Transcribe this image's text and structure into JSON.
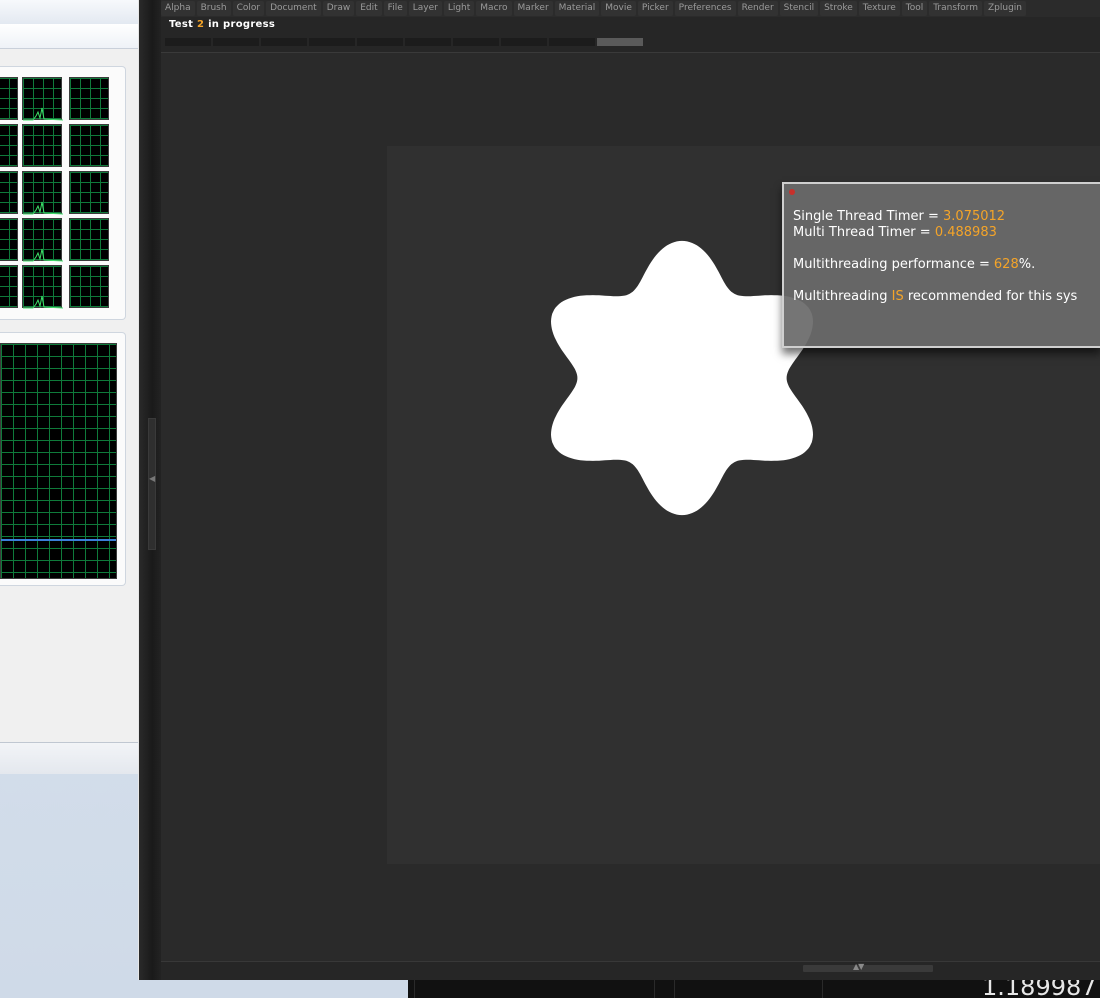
{
  "zbrush": {
    "menu": [
      "Alpha",
      "Brush",
      "Color",
      "Document",
      "Draw",
      "Edit",
      "File",
      "Layer",
      "Light",
      "Macro",
      "Marker",
      "Material",
      "Movie",
      "Picker",
      "Preferences",
      "Render",
      "Stencil",
      "Stroke",
      "Texture",
      "Tool",
      "Transform",
      "Zplugin"
    ],
    "status": {
      "prefix": "Test",
      "number": "2",
      "suffix": "in progress"
    },
    "progress": {
      "segments": 10,
      "completed_segment": 10
    },
    "dialog": {
      "single_label": "Single Thread Timer =",
      "single_value": "3.075012",
      "multi_label": "Multi Thread Timer =",
      "multi_value": "0.488983",
      "perf_label": "Multithreading performance =",
      "perf_value": "628",
      "perf_suffix": "%.",
      "rec_prefix": "Multithreading",
      "rec_highlight": "IS",
      "rec_suffix": "recommended for this sys"
    }
  },
  "taskbar": {
    "value": "1.189987"
  },
  "colors": {
    "accent_orange": "#f4a429",
    "close_red": "#c8302b",
    "graph_green": "#0f7a3a",
    "cpu_trace": "#3fe06a",
    "mem_line": "#3a7fd8"
  },
  "icons": {
    "left_handle": "triangle-left-icon",
    "bottom_handle": "triangle-up-down-icon"
  }
}
